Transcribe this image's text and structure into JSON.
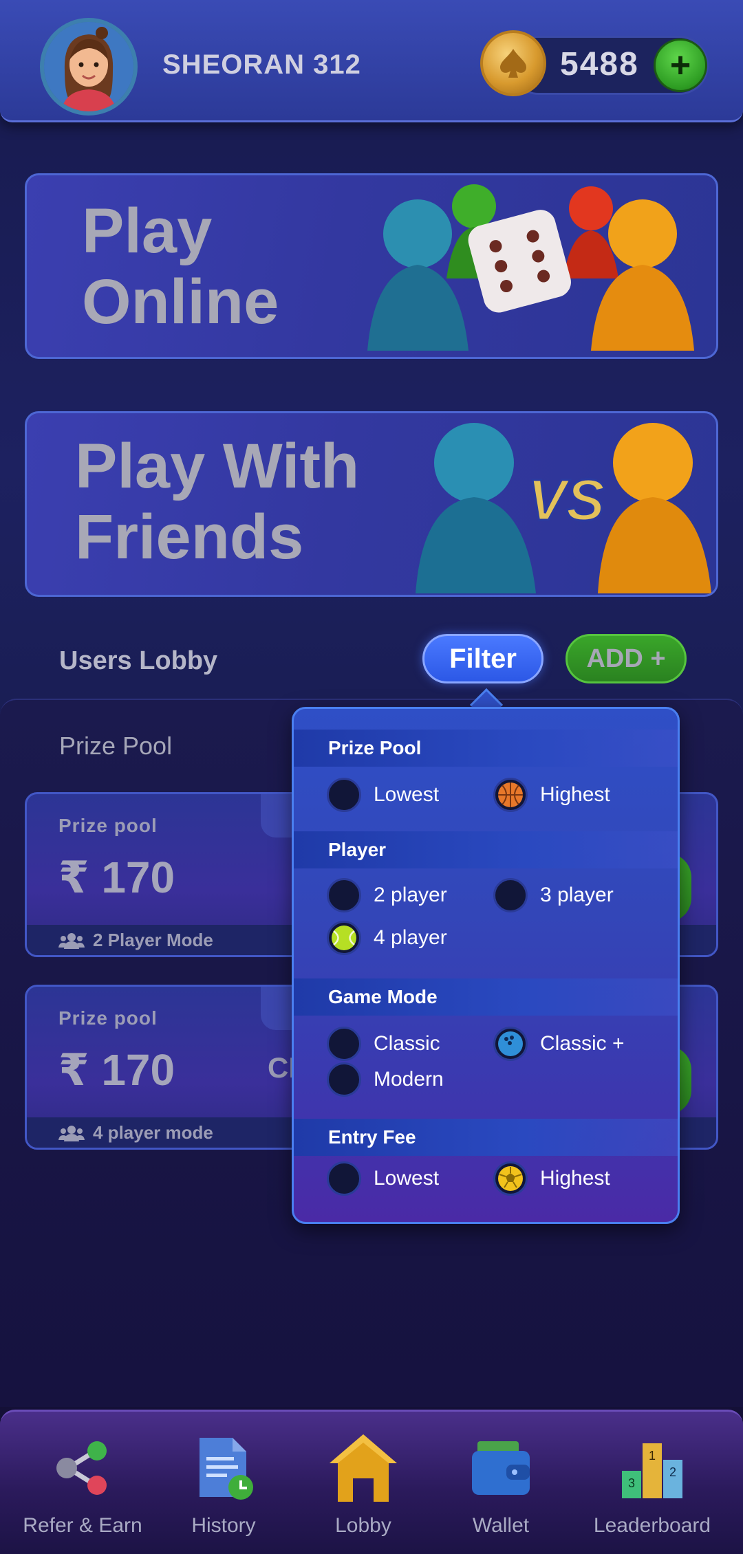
{
  "header": {
    "username": "SHEORAN 312",
    "coins": "5488",
    "add_coins_label": "+"
  },
  "banners": {
    "play_online": {
      "line1": "Play",
      "line2": "Online"
    },
    "play_friends": {
      "line1": "Play With",
      "line2": "Friends",
      "vs_label": "VS"
    }
  },
  "lobby": {
    "title": "Users Lobby",
    "filter_label": "Filter",
    "add_label": "ADD +",
    "prize_pool_heading": "Prize Pool",
    "cards": [
      {
        "label": "Prize pool",
        "value": "₹ 170",
        "mode": "2 Player Mode",
        "extra": ""
      },
      {
        "label": "Prize pool",
        "value": "₹ 170",
        "mode": "4 player mode",
        "extra": "CL"
      }
    ]
  },
  "filter": {
    "sections": {
      "prize_pool": {
        "title": "Prize Pool",
        "options": [
          {
            "label": "Lowest",
            "selected": false
          },
          {
            "label": "Highest",
            "selected": true,
            "icon": "basketball-icon"
          }
        ]
      },
      "player": {
        "title": "Player",
        "options": [
          {
            "label": "2 player",
            "selected": false
          },
          {
            "label": "3 player",
            "selected": false
          },
          {
            "label": "4 player",
            "selected": true,
            "icon": "tennis-ball-icon"
          }
        ]
      },
      "game_mode": {
        "title": "Game Mode",
        "options": [
          {
            "label": "Classic",
            "selected": false
          },
          {
            "label": "Classic +",
            "selected": true,
            "icon": "bowling-ball-icon"
          },
          {
            "label": "Modern",
            "selected": false
          }
        ]
      },
      "entry_fee": {
        "title": "Entry Fee",
        "options": [
          {
            "label": "Lowest",
            "selected": false
          },
          {
            "label": "Highest",
            "selected": true,
            "icon": "soccer-ball-icon"
          }
        ]
      }
    }
  },
  "nav": {
    "items": [
      {
        "label": "Refer & Earn",
        "icon": "share-icon"
      },
      {
        "label": "History",
        "icon": "history-document-icon"
      },
      {
        "label": "Lobby",
        "icon": "home-icon"
      },
      {
        "label": "Wallet",
        "icon": "wallet-icon"
      },
      {
        "label": "Leaderboard",
        "icon": "podium-icon"
      }
    ]
  },
  "colors": {
    "accent_blue": "#2c58e6",
    "accent_green": "#2e9d23",
    "coin_gold": "#d89a2e"
  }
}
